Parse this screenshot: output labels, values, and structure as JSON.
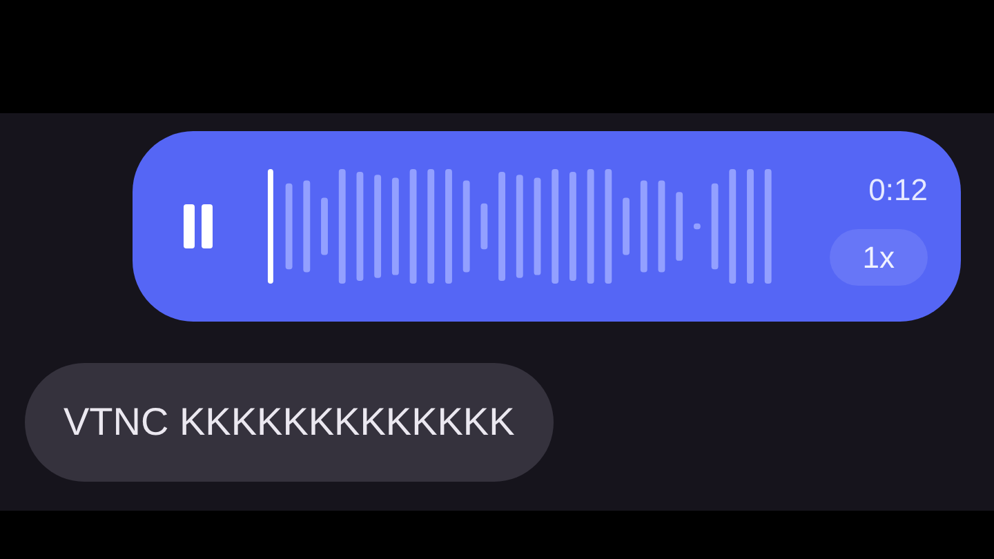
{
  "messages": [
    {
      "kind": "voice",
      "playing": true,
      "duration": "0:12",
      "speed": "1x"
    },
    {
      "kind": "text",
      "text": "VTNC KKKKKKKKKKKKK"
    }
  ]
}
